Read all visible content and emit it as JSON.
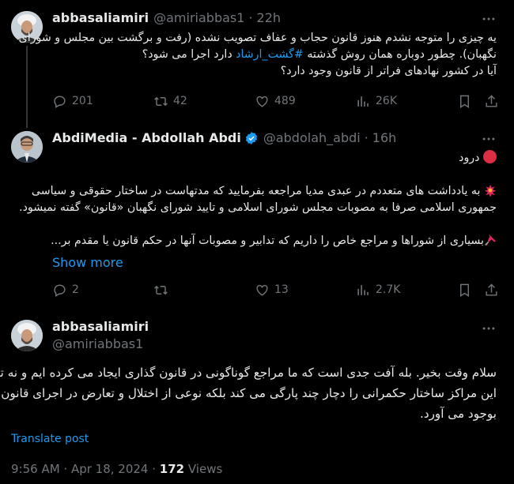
{
  "tweet1": {
    "name": "abbasaliamiri",
    "handle": "@amiriabbas1",
    "time": "22h",
    "line1": "یه چیزی را متوجه نشدم هنوز قانون حجاب و عفاف تصویب نشده (رفت و برگشت بین مجلس و شورای",
    "line2_pre": "نگهبان). چطور دوباره همان روش گذشته ",
    "hashtag": "#گشت_ارشاد",
    "line2_post": " دارد اجرا می شود؟",
    "line3": "آیا در کشور نهادهای فراتر از قانون وجود دارد؟",
    "replies": "201",
    "reposts": "42",
    "likes": "489",
    "views": "26K"
  },
  "tweet2": {
    "name": "AbdiMedia - Abdollah Abdi",
    "handle": "@abdolah_abdi",
    "time": "16h",
    "greeting": "درود",
    "para1_line1": "به یادداشت های متعددم در عبدی مدیا مراجعه بفرمایید که مدتهاست در ساختار حقوقی و سیاسی",
    "para1_line2": "جمهوری اسلامی صرفا به مصوبات مجلس شورای اسلامی و تایید شورای نگهبان «قانون» گفته نمیشود.",
    "para2_line1": "بسیاری از شوراها و مراجع خاص را داریم که تدابیر و مصوبات آنها در حکم قانون یا مقدم بر...",
    "show_more": "Show more",
    "replies": "2",
    "reposts": "",
    "likes": "13",
    "views": "2.7K"
  },
  "tweet3": {
    "name": "abbasaliamiri",
    "handle": "@amiriabbas1",
    "line1": "سلام وقت بخیر. بله آفت جدی است که ما مراجع گوناگونی در قانون گذاری ایجاد می کرده ایم و نه تنها",
    "line2": "این مراکز ساختار حکمرانی را دچار چند پارگی می کند بلکه نوعی از اختلال و تعارض در اجرای قانون",
    "line3": "بوجود می آورد.",
    "translate": "Translate post",
    "timestamp": "9:56 AM · Apr 18, 2024 · ",
    "views_count": "172",
    "views_label": " Views"
  },
  "colors": {
    "background": "#000000",
    "text": "#e7e9ea",
    "muted": "#71767b",
    "accent": "#1d9bf0",
    "verified": "#1d9bf0"
  },
  "icons": [
    "more-icon",
    "reply-icon",
    "repost-icon",
    "like-icon",
    "views-icon",
    "bookmark-icon",
    "share-icon",
    "verified-icon",
    "red-circle-icon",
    "collision-icon",
    "pushpin-icon"
  ]
}
